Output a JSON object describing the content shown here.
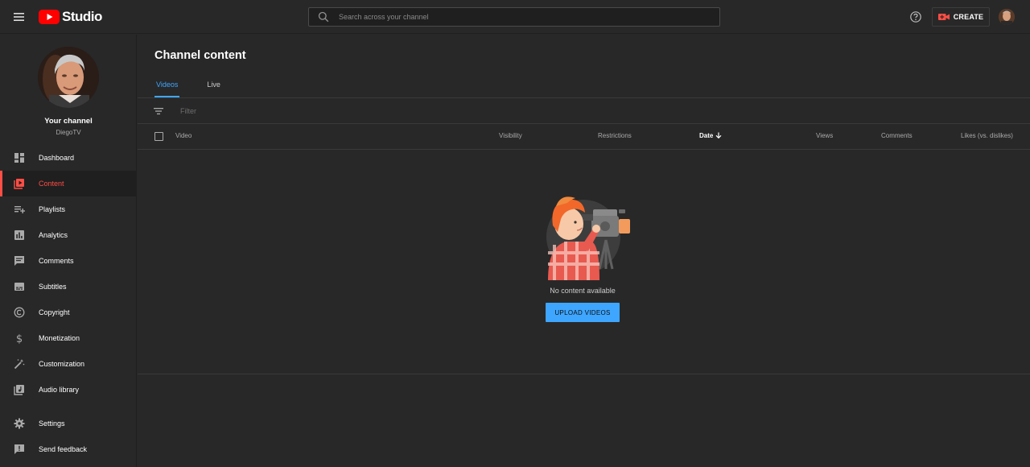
{
  "topbar": {
    "logo_text": "Studio",
    "search_placeholder": "Search across your channel",
    "create_label": "CREATE"
  },
  "sidebar": {
    "channel_title": "Your channel",
    "channel_name": "DiegoTV",
    "items": [
      {
        "label": "Dashboard",
        "icon": "dashboard-icon"
      },
      {
        "label": "Content",
        "icon": "content-icon",
        "active": true
      },
      {
        "label": "Playlists",
        "icon": "playlists-icon"
      },
      {
        "label": "Analytics",
        "icon": "analytics-icon"
      },
      {
        "label": "Comments",
        "icon": "comments-icon"
      },
      {
        "label": "Subtitles",
        "icon": "subtitles-icon"
      },
      {
        "label": "Copyright",
        "icon": "copyright-icon"
      },
      {
        "label": "Monetization",
        "icon": "monetization-icon"
      },
      {
        "label": "Customization",
        "icon": "customization-icon"
      },
      {
        "label": "Audio library",
        "icon": "audio-library-icon"
      }
    ],
    "bottom_items": [
      {
        "label": "Settings",
        "icon": "settings-icon"
      },
      {
        "label": "Send feedback",
        "icon": "feedback-icon"
      }
    ]
  },
  "main": {
    "title": "Channel content",
    "tabs": [
      {
        "label": "Videos",
        "active": true
      },
      {
        "label": "Live"
      }
    ],
    "filter_placeholder": "Filter",
    "columns": {
      "video": "Video",
      "visibility": "Visibility",
      "restrictions": "Restrictions",
      "date": "Date",
      "views": "Views",
      "comments": "Comments",
      "likes": "Likes (vs. dislikes)"
    },
    "empty_text": "No content available",
    "upload_label": "UPLOAD VIDEOS"
  },
  "colors": {
    "background": "#282828",
    "accent_red": "#ff4e45",
    "accent_blue": "#3ea6ff"
  }
}
